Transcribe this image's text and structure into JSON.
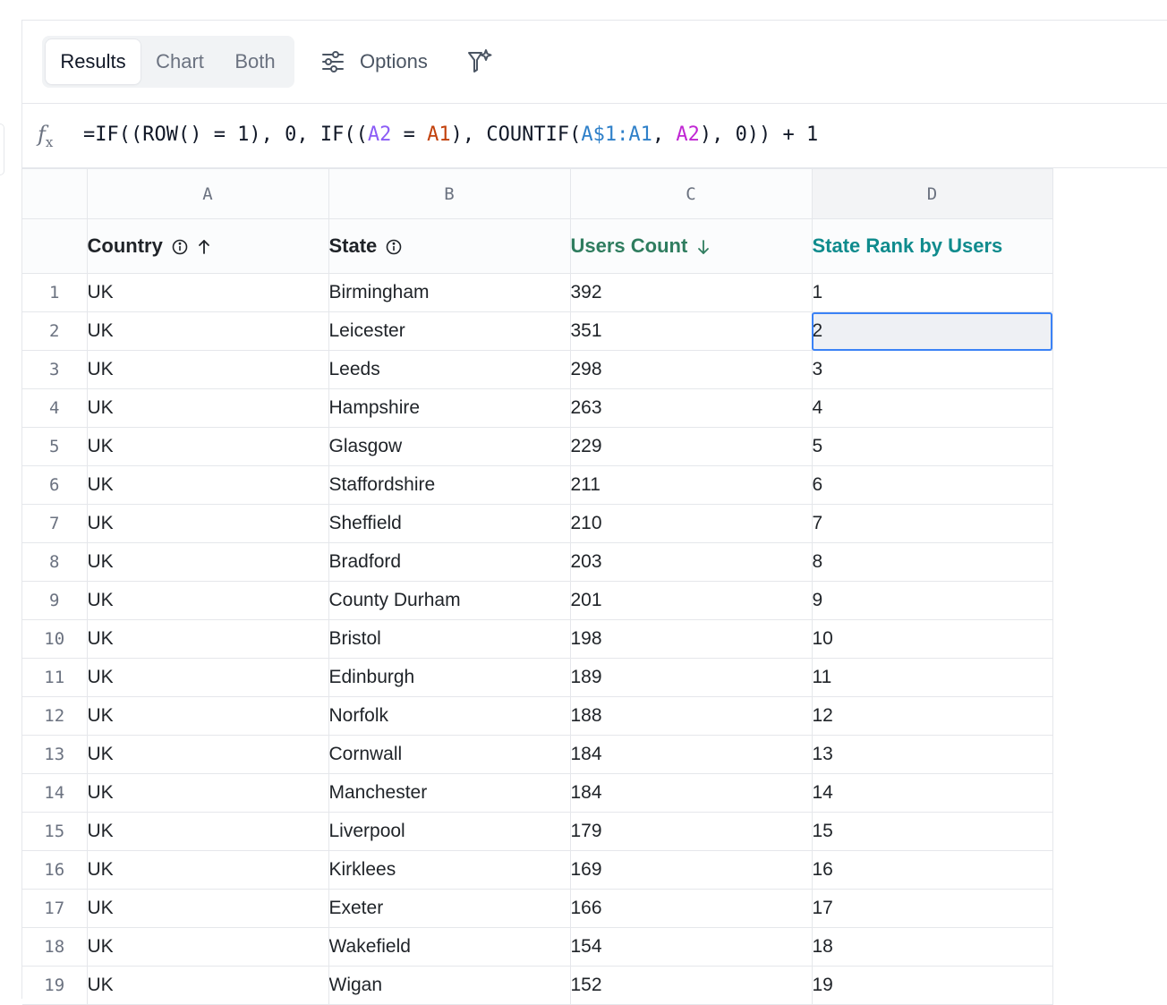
{
  "toolbar": {
    "tabs": [
      {
        "label": "Results",
        "active": true
      },
      {
        "label": "Chart",
        "active": false
      },
      {
        "label": "Both",
        "active": false
      }
    ],
    "options_label": "Options"
  },
  "formula_bar": {
    "icon": "function-icon",
    "fx_label": "f",
    "fx_sub": "x",
    "parts": [
      {
        "text": "=IF((ROW() = 1), 0, IF((",
        "color": "default"
      },
      {
        "text": "A2",
        "color": "purple"
      },
      {
        "text": " = ",
        "color": "default"
      },
      {
        "text": "A1",
        "color": "orange"
      },
      {
        "text": "), COUNTIF(",
        "color": "default"
      },
      {
        "text": "A$1:A1",
        "color": "blue"
      },
      {
        "text": ", ",
        "color": "default"
      },
      {
        "text": "A2",
        "color": "pink"
      },
      {
        "text": "), 0)) + 1",
        "color": "default"
      }
    ]
  },
  "grid": {
    "column_letters": [
      "A",
      "B",
      "C",
      "D"
    ],
    "selected_column": "D",
    "field_headers": [
      {
        "label": "Country",
        "info_icon": true,
        "sort": "asc"
      },
      {
        "label": "State",
        "info_icon": true,
        "sort": null
      },
      {
        "label": "Users Count",
        "info_icon": false,
        "sort": "desc"
      },
      {
        "label": "State Rank by Users",
        "info_icon": false,
        "sort": null
      }
    ],
    "selected_cell": {
      "row": 2,
      "column": "D"
    },
    "rows": [
      [
        "1",
        "UK",
        "Birmingham",
        "392",
        "1"
      ],
      [
        "2",
        "UK",
        "Leicester",
        "351",
        "2"
      ],
      [
        "3",
        "UK",
        "Leeds",
        "298",
        "3"
      ],
      [
        "4",
        "UK",
        "Hampshire",
        "263",
        "4"
      ],
      [
        "5",
        "UK",
        "Glasgow",
        "229",
        "5"
      ],
      [
        "6",
        "UK",
        "Staffordshire",
        "211",
        "6"
      ],
      [
        "7",
        "UK",
        "Sheffield",
        "210",
        "7"
      ],
      [
        "8",
        "UK",
        "Bradford",
        "203",
        "8"
      ],
      [
        "9",
        "UK",
        "County Durham",
        "201",
        "9"
      ],
      [
        "10",
        "UK",
        "Bristol",
        "198",
        "10"
      ],
      [
        "11",
        "UK",
        "Edinburgh",
        "189",
        "11"
      ],
      [
        "12",
        "UK",
        "Norfolk",
        "188",
        "12"
      ],
      [
        "13",
        "UK",
        "Cornwall",
        "184",
        "13"
      ],
      [
        "14",
        "UK",
        "Manchester",
        "184",
        "14"
      ],
      [
        "15",
        "UK",
        "Liverpool",
        "179",
        "15"
      ],
      [
        "16",
        "UK",
        "Kirklees",
        "169",
        "16"
      ],
      [
        "17",
        "UK",
        "Exeter",
        "166",
        "17"
      ],
      [
        "18",
        "UK",
        "Wakefield",
        "154",
        "18"
      ],
      [
        "19",
        "UK",
        "Wigan",
        "152",
        "19"
      ]
    ]
  }
}
